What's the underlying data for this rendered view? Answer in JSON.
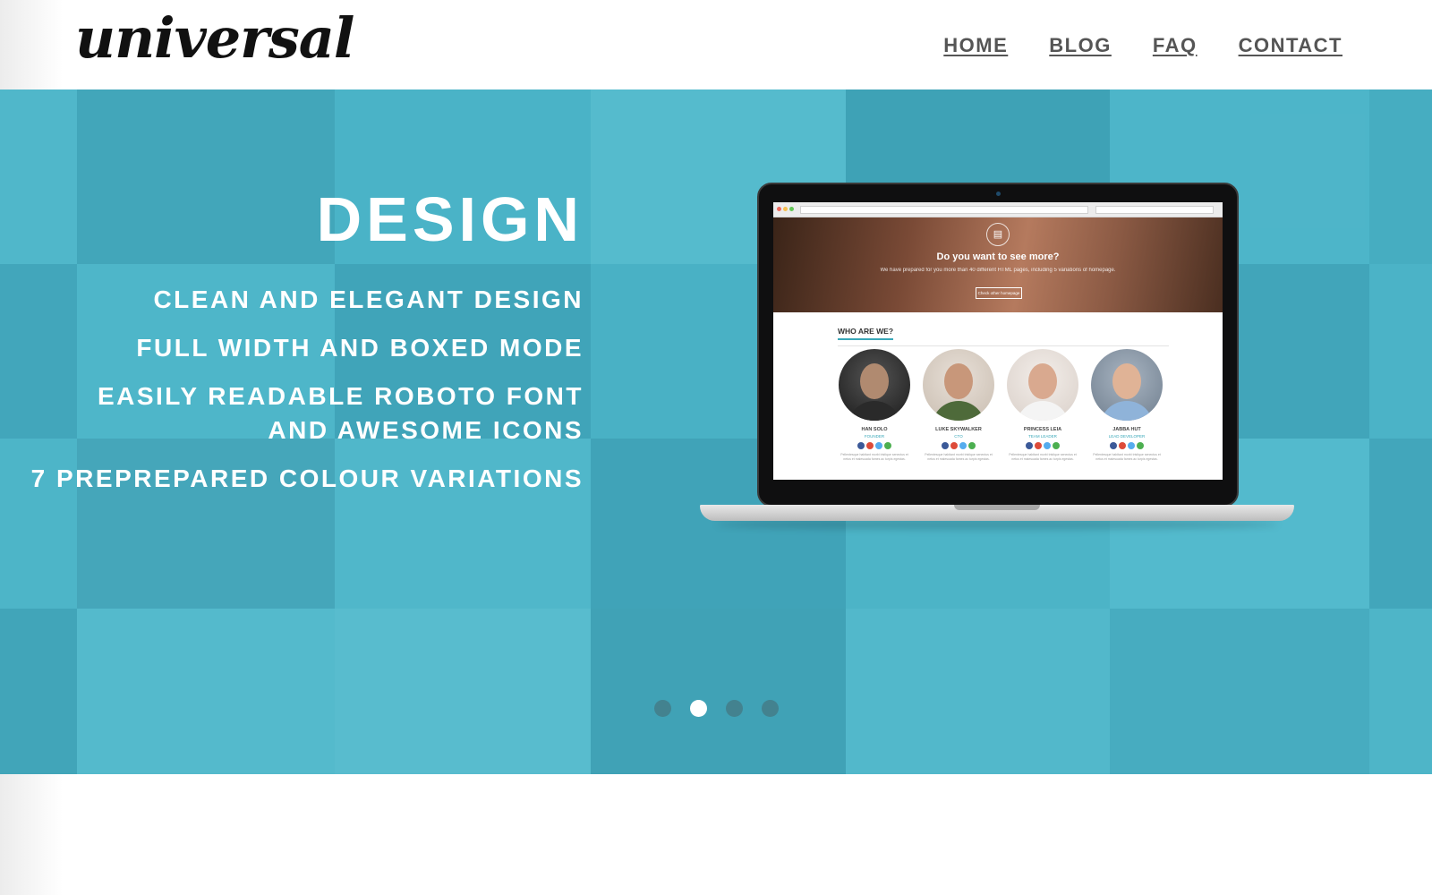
{
  "header": {
    "logo_text": "universal",
    "nav": [
      {
        "label": "HOME"
      },
      {
        "label": "BLOG"
      },
      {
        "label": "FAQ"
      },
      {
        "label": "CONTACT"
      }
    ]
  },
  "hero": {
    "title": "DESIGN",
    "features": [
      "CLEAN AND ELEGANT DESIGN",
      "FULL WIDTH AND BOXED MODE",
      "EASILY READABLE ROBOTO FONT AND AWESOME ICONS",
      "7 PREPREPARED COLOUR VARIATIONS"
    ],
    "slide_count": 4,
    "active_slide": 2
  },
  "laptop_screen": {
    "banner_title": "Do you want to see more?",
    "banner_subtitle": "We have prepared for you more than 40 different HTML pages, including 5 variations of homepage.",
    "banner_button": "Check other homepage",
    "section_title": "WHO ARE WE?",
    "team": [
      {
        "name": "HAN SOLO",
        "role": "FOUNDER",
        "bio": "Pellentesque habitant morbi tristique senectus et netus et malesuada fames ac turpis egestas."
      },
      {
        "name": "LUKE SKYWALKER",
        "role": "CTO",
        "bio": "Pellentesque habitant morbi tristique senectus et netus et malesuada fames ac turpis egestas."
      },
      {
        "name": "PRINCESS LEIA",
        "role": "TEAM LEADER",
        "bio": "Pellentesque habitant morbi tristique senectus et netus et malesuada fames ac turpis egestas."
      },
      {
        "name": "JABBA HUT",
        "role": "LEAD DEVELOPER",
        "bio": "Pellentesque habitant morbi tristique senectus et netus et malesuada fames ac turpis egestas."
      }
    ]
  },
  "colors": {
    "hero_bg": "#45b0c5",
    "accent": "#38a7b8",
    "nav_text": "#555555",
    "social": [
      "#3b5998",
      "#dd4b39",
      "#55acee",
      "#4caf50"
    ]
  }
}
